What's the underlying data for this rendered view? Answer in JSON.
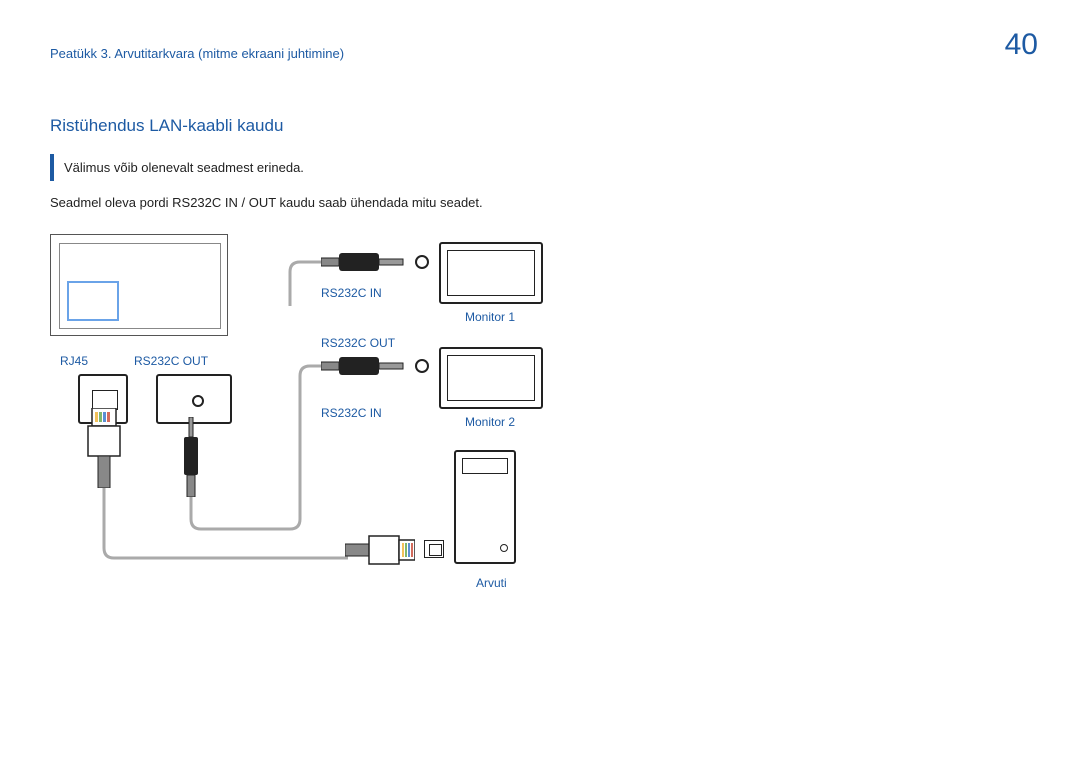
{
  "header": {
    "breadcrumb": "Peatükk 3. Arvutitarkvara (mitme ekraani juhtimine)",
    "page_number": "40"
  },
  "section": {
    "title": "Ristühendus LAN-kaabli kaudu",
    "callout": "Välimus võib olenevalt seadmest erineda.",
    "body": "Seadmel oleva pordi RS232C IN / OUT kaudu saab ühendada mitu seadet."
  },
  "diagram": {
    "labels": {
      "rj45": "RJ45",
      "rs232c_out_left": "RS232C OUT",
      "rs232c_in_top": "RS232C IN",
      "rs232c_out_mid": "RS232C OUT",
      "rs232c_in_bottom": "RS232C IN",
      "monitor1": "Monitor 1",
      "monitor2": "Monitor 2",
      "arvuti": "Arvuti"
    }
  }
}
